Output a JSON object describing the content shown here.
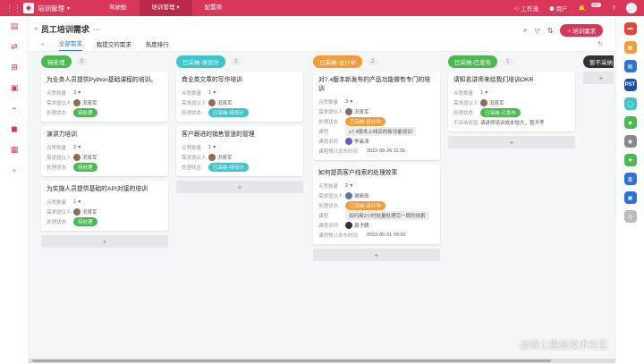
{
  "topbar": {
    "app_title": "培训管理",
    "nav": [
      "驾驶舱",
      "培训管理",
      "配置项"
    ],
    "nav_active": 1,
    "workbench": "工作流",
    "user": "用户",
    "badge": "99+"
  },
  "header": {
    "title": "员工培训需求",
    "more": "···",
    "add_button": "+ 培训需求",
    "tabs": [
      "全部需求",
      "我提交的需求",
      "热度排行"
    ],
    "tab_active": 0
  },
  "labels": {
    "likes": "点赞数量",
    "requester": "需求提议人",
    "status": "处理状态",
    "course": "课程",
    "instructor": "课程讲师",
    "planned": "课程预计发布时间",
    "reason": "不采纳原因"
  },
  "columns": [
    {
      "name": "待处理",
      "color": "#4cb852",
      "count": "3",
      "cards": [
        {
          "title": "为业务人员提供Python基础课程的培训。",
          "likes": "3",
          "requester": "况育军",
          "status": "待处理"
        },
        {
          "title": "演讲力培训",
          "likes": "2",
          "requester": "况育军",
          "status": "待处理"
        },
        {
          "title": "为实施人员提供基础的API对接的培训",
          "likes": "1",
          "requester": "况育军",
          "status": "待处理"
        }
      ]
    },
    {
      "name": "已采纳-待设计",
      "color": "#3ec4c9",
      "count": "2",
      "cards": [
        {
          "title": "商业类文章的写作培训",
          "likes": "1",
          "requester": "况育军",
          "status": "已采纳-待设计"
        },
        {
          "title": "客户跟进的销售管道的管理",
          "likes": "1",
          "requester": "况育军",
          "status": "已采纳-待设计"
        }
      ]
    },
    {
      "name": "已采纳-设计中",
      "color": "#f39c3a",
      "count": "2",
      "cards": [
        {
          "title": "对7.4版本新发布的产品功能做有专门的培训",
          "likes": "3",
          "requester": "况育军",
          "status": "已采纳-设计中",
          "course": "v7.4版本上线后的新功能培训",
          "instructor": "李晨涛",
          "planned": "2022-05-26 11:36"
        },
        {
          "title": "如何提高客户线索的处理效率",
          "likes": "2",
          "requester": "谢昕辰",
          "status": "已采纳-设计中",
          "course": "如何用2小时批量处理完一周的线索",
          "instructor": "周子朗",
          "planned": "2022-05-31 09:30"
        }
      ]
    },
    {
      "name": "已采纳-已发布",
      "color": "#4cb852",
      "count": "1",
      "cards": [
        {
          "title": "请知名讲师来给我们培训OKR",
          "likes": "1",
          "requester": "况育军",
          "status": "已采纳-已发布",
          "reason": "请讲师培训成本较大，暂不考"
        }
      ]
    },
    {
      "name": "暂不采纳",
      "color": "#333333",
      "count": "",
      "cards": []
    }
  ],
  "icons": {
    "grid": "grid-icon",
    "app": "app-icon",
    "search": "search-icon",
    "filter": "filter-icon",
    "sort": "sort-icon",
    "refresh": "refresh-icon",
    "plus": "plus-icon"
  },
  "watermark": "@稀土掘金技术社区"
}
